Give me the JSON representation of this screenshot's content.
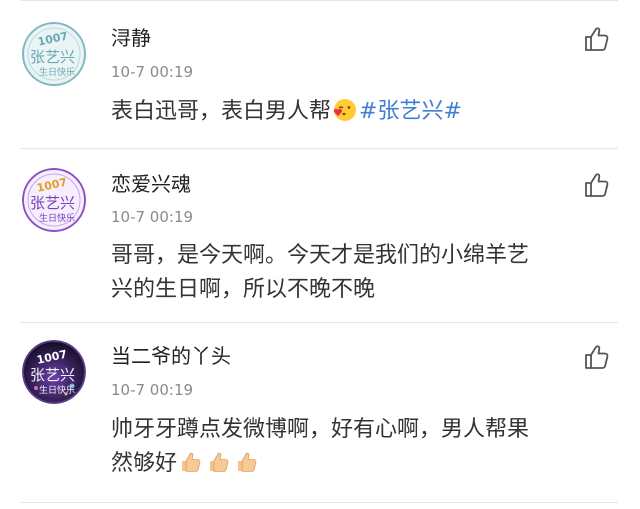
{
  "comments": [
    {
      "username": "浔静",
      "timestamp": "10-7 00:19",
      "text_before": "表白迅哥，表白男人帮",
      "emoji": "kissing-heart-emoji",
      "hashtag": "#张艺兴#",
      "avatar": {
        "number": "1007",
        "name": "张艺兴",
        "tagline": "生日快乐",
        "style": "teal",
        "colors": {
          "bg": "#eaf4f4",
          "ring": "#7fb8c2",
          "text": "#6aa9b4"
        }
      }
    },
    {
      "username": "恋爱兴魂",
      "timestamp": "10-7 00:19",
      "text": "哥哥，是今天啊。今天才是我们的小绵羊艺兴的生日啊，所以不晚不晚",
      "line1": "哥哥，是今天啊。今天才是我们的小绵羊艺",
      "line2": "兴的生日啊，所以不晚不晚",
      "avatar": {
        "number": "1007",
        "name": "张艺兴",
        "tagline": "生日快乐",
        "style": "purple",
        "colors": {
          "bg": "#f7efff",
          "ring": "#8b4fc7",
          "text": "#7a3fb6"
        }
      }
    },
    {
      "username": "当二爷的丫头",
      "timestamp": "10-7 00:19",
      "line1": "帅牙牙蹲点发微博啊，好有心啊，男人帮果",
      "line2": "然够好",
      "emojis": [
        "thumbs-up-emoji",
        "thumbs-up-emoji",
        "thumbs-up-emoji"
      ],
      "avatar": {
        "number": "1007",
        "name": "张艺兴",
        "tagline": "生日快乐",
        "style": "night",
        "colors": {
          "bg": "#1d1430",
          "ring": "#5a3c8a",
          "text": "#f3f0ff"
        }
      }
    }
  ],
  "icons": {
    "like": "thumbs-up-outline-icon"
  },
  "colors": {
    "hashtag": "#3f7ed6",
    "timestamp": "#8a8a8a",
    "text": "#333333",
    "divider": "#e6e6e6"
  }
}
